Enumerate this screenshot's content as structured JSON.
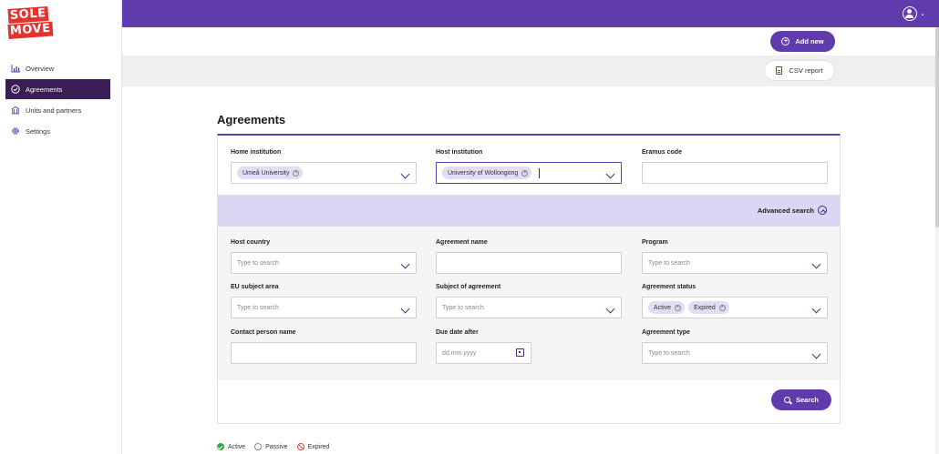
{
  "app": {
    "logo_line1": "SOLE",
    "logo_line2": "MOVE"
  },
  "sidebar": {
    "items": [
      {
        "label": "Overview",
        "icon": "chart-icon"
      },
      {
        "label": "Agreements",
        "icon": "check-circle-icon",
        "active": true
      },
      {
        "label": "Units and partners",
        "icon": "building-icon"
      },
      {
        "label": "Settings",
        "icon": "gear-icon"
      }
    ]
  },
  "toolbar": {
    "add_label": "Add new",
    "csv_label": "CSV report"
  },
  "page": {
    "title": "Agreements"
  },
  "form": {
    "home_institution": {
      "label": "Home institution",
      "chips": [
        "Umeå University"
      ]
    },
    "host_institution": {
      "label": "Host institution",
      "chips": [
        "University of Wollongong"
      ]
    },
    "erasmus_code": {
      "label": "Eramus code",
      "value": ""
    },
    "advanced_search_label": "Advanced search",
    "host_country": {
      "label": "Host country",
      "placeholder": "Type to search"
    },
    "agreement_name": {
      "label": "Agreement name",
      "value": ""
    },
    "program": {
      "label": "Program",
      "placeholder": "Type to search"
    },
    "eu_subject_area": {
      "label": "EU subject area",
      "placeholder": "Type to search"
    },
    "subject_of_agreement": {
      "label": "Subject of agreement",
      "placeholder": "Type to search"
    },
    "agreement_status": {
      "label": "Agreement status",
      "chips": [
        "Active",
        "Expired"
      ]
    },
    "contact_person_name": {
      "label": "Contact person name",
      "value": ""
    },
    "due_date_after": {
      "label": "Due date after",
      "placeholder": "dd.mm.yyyy"
    },
    "agreement_type": {
      "label": "Agreement type",
      "placeholder": "Type to search"
    },
    "search_label": "Search"
  },
  "legend": {
    "active": "Active",
    "passive": "Passive",
    "expired": "Expired"
  },
  "colors": {
    "brand_purple": "#5f3bab",
    "sidebar_active": "#3b1d55",
    "advanced_bar": "#dcd6f5",
    "logo_red": "#e6322e"
  }
}
